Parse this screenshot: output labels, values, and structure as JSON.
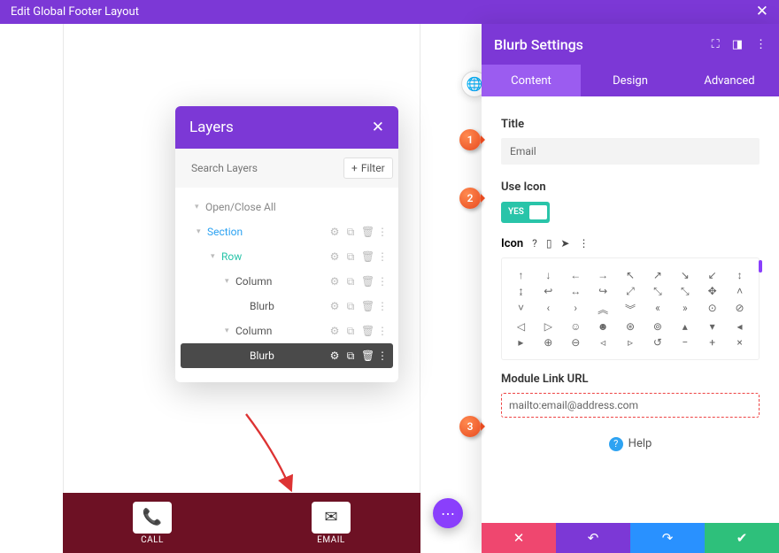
{
  "topbar": {
    "title": "Edit Global Footer Layout"
  },
  "layers": {
    "title": "Layers",
    "search_placeholder": "Search Layers",
    "filter": "Filter",
    "open_close": "Open/Close All",
    "tree": {
      "section": "Section",
      "row": "Row",
      "column1": "Column",
      "blurb1": "Blurb",
      "column2": "Column",
      "blurb2": "Blurb"
    }
  },
  "footer_icons": {
    "call": "CALL",
    "email": "EMAIL"
  },
  "panel": {
    "title": "Blurb Settings",
    "tabs": {
      "content": "Content",
      "design": "Design",
      "advanced": "Advanced"
    },
    "title_field": {
      "label": "Title",
      "value": "Email"
    },
    "use_icon": {
      "label": "Use Icon",
      "toggle": "YES"
    },
    "icon_label": "Icon",
    "module_url": {
      "label": "Module Link URL",
      "value": "mailto:email@address.com"
    },
    "help": "Help"
  },
  "callouts": {
    "one": "1",
    "two": "2",
    "three": "3"
  }
}
